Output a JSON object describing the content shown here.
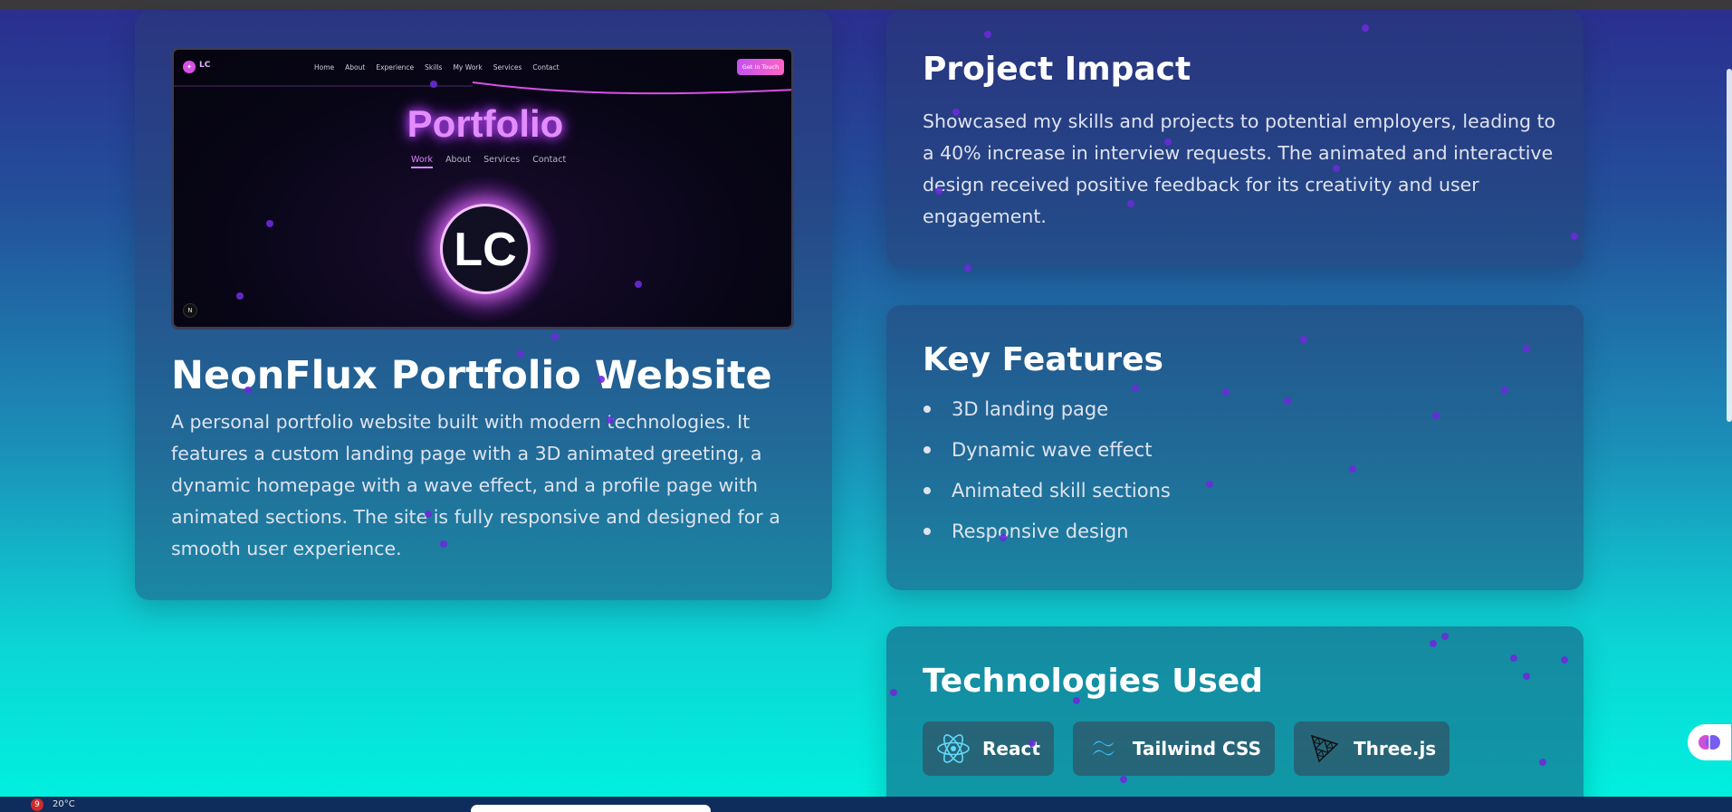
{
  "thumbnail": {
    "logo": "LC",
    "nav": [
      "Home",
      "About",
      "Experience",
      "Skills",
      "My Work",
      "Services",
      "Contact"
    ],
    "cta": "Get In Touch",
    "title": "Portfolio",
    "tabs": [
      "Work",
      "About",
      "Services",
      "Contact"
    ],
    "avatar": "LC",
    "corner_badge": "N"
  },
  "project": {
    "title": "NeonFlux Portfolio Website",
    "description": "A personal portfolio website built with modern technologies. It features a custom landing page with a 3D animated greeting, a dynamic homepage with a wave effect, and a profile page with animated sections. The site is fully responsive and designed for a smooth user experience."
  },
  "impact": {
    "title": "Project Impact",
    "text": "Showcased my skills and projects to potential employers, leading to a 40% increase in interview requests. The animated and interactive design received positive feedback for its creativity and user engagement."
  },
  "features": {
    "title": "Key Features",
    "items": [
      "3D landing page",
      "Dynamic wave effect",
      "Animated skill sections",
      "Responsive design"
    ]
  },
  "technologies": {
    "title": "Technologies Used",
    "items": [
      {
        "name": "React",
        "icon": "react-icon"
      },
      {
        "name": "Tailwind CSS",
        "icon": "tailwind-icon"
      },
      {
        "name": "Three.js",
        "icon": "threejs-icon"
      }
    ]
  },
  "taskbar": {
    "weather_badge": "9",
    "temperature": "20°C"
  },
  "colors": {
    "accent": "#d886ff",
    "particle": "#6a2bd8",
    "react": "#61dafb",
    "tailwind": "#38bdf8"
  }
}
